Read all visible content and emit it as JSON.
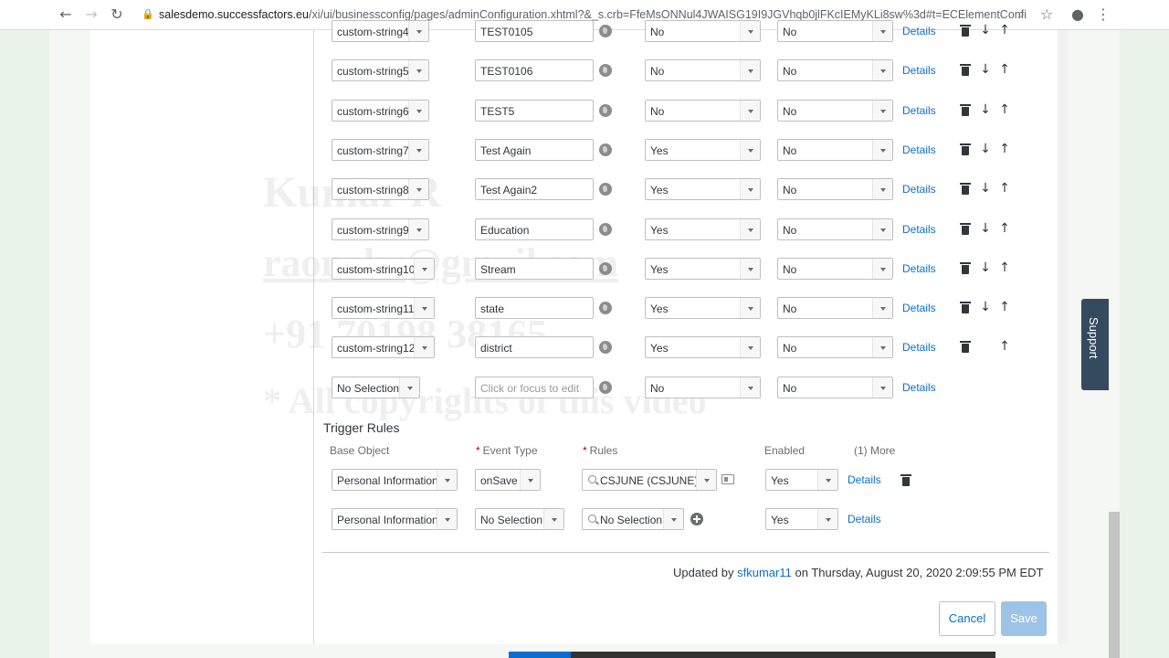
{
  "browser": {
    "url_host": "salesdemo.successfactors.eu",
    "url_rest": "/xi/ui/businessconfig/pages/adminConfiguration.xhtml?&_s.crb=FfeMsONNul4JWAISG19I9JGVhqb0jlFKcIEMyKLi8sw%3d#t=ECElementConfig&i..."
  },
  "rows": [
    {
      "field": "custom-string4",
      "label": "TEST0105",
      "vis1": "No",
      "vis2": "No",
      "details": "Details",
      "down": true,
      "up": true
    },
    {
      "field": "custom-string5",
      "label": "TEST0106",
      "vis1": "No",
      "vis2": "No",
      "details": "Details",
      "down": true,
      "up": true
    },
    {
      "field": "custom-string6",
      "label": "TEST5",
      "vis1": "No",
      "vis2": "No",
      "details": "Details",
      "down": true,
      "up": true
    },
    {
      "field": "custom-string7",
      "label": "Test Again",
      "vis1": "Yes",
      "vis2": "No",
      "details": "Details",
      "down": true,
      "up": true
    },
    {
      "field": "custom-string8",
      "label": "Test Again2",
      "vis1": "Yes",
      "vis2": "No",
      "details": "Details",
      "down": true,
      "up": true
    },
    {
      "field": "custom-string9",
      "label": "Education",
      "vis1": "Yes",
      "vis2": "No",
      "details": "Details",
      "down": true,
      "up": true
    },
    {
      "field": "custom-string10",
      "label": "Stream",
      "vis1": "Yes",
      "vis2": "No",
      "details": "Details",
      "down": true,
      "up": true
    },
    {
      "field": "custom-string11",
      "label": "state",
      "vis1": "Yes",
      "vis2": "No",
      "details": "Details",
      "down": true,
      "up": true
    },
    {
      "field": "custom-string12",
      "label": "district",
      "vis1": "Yes",
      "vis2": "No",
      "details": "Details",
      "down": false,
      "up": true
    },
    {
      "field": "No Selection",
      "label": "",
      "placeholder": "Click or focus to edit",
      "vis1": "No",
      "vis2": "No",
      "details": "Details",
      "down": false,
      "up": false,
      "no_trash": true
    }
  ],
  "trigger_rules": {
    "title": "Trigger Rules",
    "headers": {
      "base_object": "Base Object",
      "event_type": "Event Type",
      "rules": "Rules",
      "enabled": "Enabled",
      "more": "(1) More"
    },
    "rows": [
      {
        "base_object": "Personal Information",
        "event_type": "onSave",
        "rule": "CSJUNE (CSJUNE)",
        "enabled": "Yes",
        "details": "Details"
      },
      {
        "base_object": "Personal Information",
        "event_type": "No Selection",
        "rule": "No Selection",
        "enabled": "Yes",
        "details": "Details"
      }
    ]
  },
  "footer": {
    "updated_prefix": "Updated by",
    "updated_user": "sfkumar11",
    "updated_suffix": "on Thursday, August 20, 2020 2:09:55 PM EDT",
    "cancel": "Cancel",
    "save": "Save"
  },
  "support": "Support",
  "watermark": {
    "line1": "Kumar R",
    "line2": "raonahr@gmail.com",
    "line3": "+91 70198 38165",
    "line4": "* All copyrights of this video"
  },
  "colors": {
    "accent": "#0a6ed1",
    "save_disabled": "#9dc3e6",
    "support_tab": "#354a5f"
  }
}
